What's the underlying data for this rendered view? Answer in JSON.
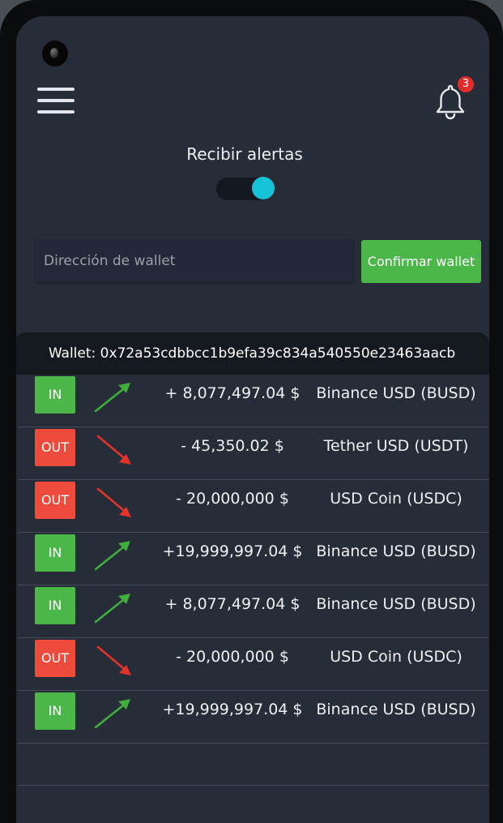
{
  "header": {
    "menu_icon": "hamburger-menu-icon",
    "bell_icon": "bell-icon",
    "notification_count": "3"
  },
  "alerts": {
    "label": "Recibir alertas",
    "enabled": true
  },
  "wallet_form": {
    "placeholder": "Dirección de wallet",
    "value": "",
    "confirm_label": "Confirmar wallet"
  },
  "wallet_header": "Wallet: 0x72a53cdbbcc1b9efa39c834a540550e23463aacb",
  "transactions": [
    {
      "direction": "IN",
      "amount": "+ 8,077,497.04 $",
      "token": "Binance USD (BUSD)"
    },
    {
      "direction": "OUT",
      "amount": "- 45,350.02 $",
      "token": "Tether USD (USDT)"
    },
    {
      "direction": "OUT",
      "amount": "- 20,000,000 $",
      "token": "USD Coin (USDC)"
    },
    {
      "direction": "IN",
      "amount": "+19,999,997.04 $",
      "token": "Binance USD (BUSD)"
    },
    {
      "direction": "IN",
      "amount": "+ 8,077,497.04 $",
      "token": "Binance USD (BUSD)"
    },
    {
      "direction": "OUT",
      "amount": "- 20,000,000 $",
      "token": "USD Coin (USDC)"
    },
    {
      "direction": "IN",
      "amount": "+19,999,997.04 $",
      "token": "Binance USD (BUSD)"
    }
  ],
  "colors": {
    "in": "#4cb749",
    "out": "#ef4b3c",
    "arrow_up": "#3fae3c",
    "arrow_down": "#e0332a",
    "toggle_on": "#16c2d8"
  }
}
